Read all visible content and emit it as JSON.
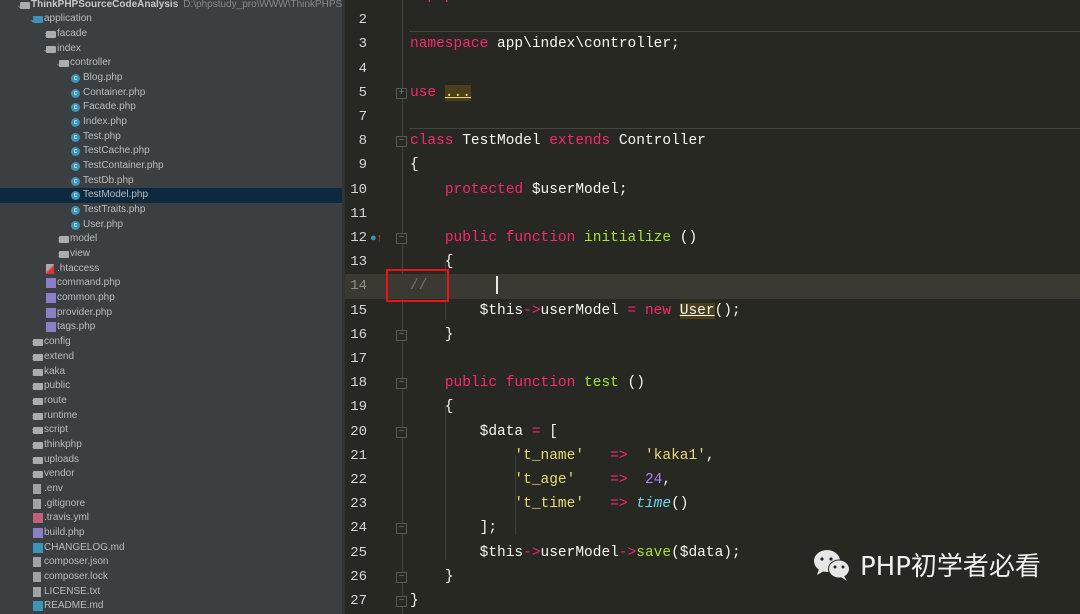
{
  "project_tree": [
    {
      "depth": 0,
      "type": "folder",
      "open": true,
      "label": "ThinkPHPSourceCodeAnalysis",
      "path": "D:\\phpstudy_pro\\WWW\\ThinkPHPSourceCodeAnalysis"
    },
    {
      "depth": 1,
      "type": "folder-blue",
      "open": true,
      "label": "application"
    },
    {
      "depth": 2,
      "type": "folder",
      "open": false,
      "label": "facade"
    },
    {
      "depth": 2,
      "type": "folder",
      "open": true,
      "label": "index"
    },
    {
      "depth": 3,
      "type": "folder",
      "open": true,
      "label": "controller"
    },
    {
      "depth": 4,
      "type": "cls",
      "label": "Blog.php"
    },
    {
      "depth": 4,
      "type": "cls",
      "label": "Container.php"
    },
    {
      "depth": 4,
      "type": "cls",
      "label": "Facade.php"
    },
    {
      "depth": 4,
      "type": "cls",
      "label": "Index.php"
    },
    {
      "depth": 4,
      "type": "cls",
      "label": "Test.php"
    },
    {
      "depth": 4,
      "type": "cls",
      "label": "TestCache.php"
    },
    {
      "depth": 4,
      "type": "cls",
      "label": "TestContainer.php"
    },
    {
      "depth": 4,
      "type": "cls",
      "label": "TestDb.php"
    },
    {
      "depth": 4,
      "type": "cls",
      "label": "TestModel.php",
      "selected": true
    },
    {
      "depth": 4,
      "type": "cls",
      "label": "TestTraits.php"
    },
    {
      "depth": 4,
      "type": "cls",
      "label": "User.php"
    },
    {
      "depth": 3,
      "type": "folder",
      "open": false,
      "label": "model"
    },
    {
      "depth": 3,
      "type": "folder",
      "open": false,
      "label": "view"
    },
    {
      "depth": 2,
      "type": "ht",
      "label": ".htaccess"
    },
    {
      "depth": 2,
      "type": "php",
      "label": "command.php"
    },
    {
      "depth": 2,
      "type": "php",
      "label": "common.php"
    },
    {
      "depth": 2,
      "type": "php",
      "label": "provider.php"
    },
    {
      "depth": 2,
      "type": "php",
      "label": "tags.php"
    },
    {
      "depth": 1,
      "type": "folder",
      "open": false,
      "label": "config"
    },
    {
      "depth": 1,
      "type": "folder",
      "open": false,
      "label": "extend"
    },
    {
      "depth": 1,
      "type": "folder",
      "open": false,
      "label": "kaka"
    },
    {
      "depth": 1,
      "type": "folder",
      "open": false,
      "label": "public"
    },
    {
      "depth": 1,
      "type": "folder",
      "open": false,
      "label": "route"
    },
    {
      "depth": 1,
      "type": "folder",
      "open": false,
      "label": "runtime"
    },
    {
      "depth": 1,
      "type": "folder",
      "open": false,
      "label": "script"
    },
    {
      "depth": 1,
      "type": "folder",
      "open": false,
      "label": "thinkphp"
    },
    {
      "depth": 1,
      "type": "folder",
      "open": false,
      "label": "uploads"
    },
    {
      "depth": 1,
      "type": "folder",
      "open": false,
      "label": "vendor"
    },
    {
      "depth": 1,
      "type": "file",
      "label": ".env"
    },
    {
      "depth": 1,
      "type": "file",
      "label": ".gitignore"
    },
    {
      "depth": 1,
      "type": "yml",
      "label": ".travis.yml"
    },
    {
      "depth": 1,
      "type": "php",
      "label": "build.php"
    },
    {
      "depth": 1,
      "type": "md",
      "label": "CHANGELOG.md"
    },
    {
      "depth": 1,
      "type": "file",
      "label": "composer.json"
    },
    {
      "depth": 1,
      "type": "file",
      "label": "composer.lock"
    },
    {
      "depth": 1,
      "type": "file",
      "label": "LICENSE.txt"
    },
    {
      "depth": 1,
      "type": "md",
      "label": "README.md"
    }
  ],
  "editor": {
    "lines": [
      {
        "n": "1",
        "tokens": [
          [
            "k",
            "<?php"
          ]
        ]
      },
      {
        "n": "2",
        "tokens": []
      },
      {
        "n": "3",
        "tokens": [
          [
            "k",
            "namespace"
          ],
          [
            "p",
            " app\\index\\controller;"
          ]
        ]
      },
      {
        "n": "4",
        "tokens": []
      },
      {
        "n": "5",
        "fold": "+",
        "tokens": [
          [
            "k",
            "use"
          ],
          [
            "p",
            " "
          ],
          [
            "s u",
            "..."
          ]
        ]
      },
      {
        "n": "7",
        "tokens": []
      },
      {
        "n": "8",
        "fold": "-",
        "tokens": [
          [
            "k",
            "class"
          ],
          [
            "p",
            " TestModel "
          ],
          [
            "k",
            "extends"
          ],
          [
            "p",
            " Controller"
          ]
        ]
      },
      {
        "n": "9",
        "tokens": [
          [
            "p",
            "{"
          ]
        ]
      },
      {
        "n": "10",
        "tokens": [
          [
            "p",
            "    "
          ],
          [
            "k",
            "protected"
          ],
          [
            "p",
            " $userModel;"
          ]
        ]
      },
      {
        "n": "11",
        "tokens": []
      },
      {
        "n": "12",
        "fold": "-",
        "override": true,
        "tokens": [
          [
            "p",
            "    "
          ],
          [
            "k",
            "public function"
          ],
          [
            "p",
            " "
          ],
          [
            "f",
            "initialize"
          ],
          [
            "p",
            " ()"
          ]
        ]
      },
      {
        "n": "13",
        "tokens": [
          [
            "p",
            "    {"
          ]
        ]
      },
      {
        "n": "14",
        "current": true,
        "tokens": [
          [
            "c",
            "//"
          ]
        ]
      },
      {
        "n": "15",
        "tokens": [
          [
            "p",
            "        $this"
          ],
          [
            "k",
            "->"
          ],
          [
            "p",
            "userModel "
          ],
          [
            "k",
            "="
          ],
          [
            "p",
            " "
          ],
          [
            "k",
            "new"
          ],
          [
            "p",
            " "
          ],
          [
            "p u",
            "User"
          ],
          [
            "p",
            "();"
          ]
        ]
      },
      {
        "n": "16",
        "fold": "-",
        "tokens": [
          [
            "p",
            "    }"
          ]
        ]
      },
      {
        "n": "17",
        "tokens": []
      },
      {
        "n": "18",
        "fold": "-",
        "tokens": [
          [
            "p",
            "    "
          ],
          [
            "k",
            "public function"
          ],
          [
            "p",
            " "
          ],
          [
            "f",
            "test"
          ],
          [
            "p",
            " ()"
          ]
        ]
      },
      {
        "n": "19",
        "tokens": [
          [
            "p",
            "    {"
          ]
        ]
      },
      {
        "n": "20",
        "fold": "-",
        "tokens": [
          [
            "p",
            "        $data "
          ],
          [
            "k",
            "="
          ],
          [
            "p",
            " ["
          ]
        ]
      },
      {
        "n": "21",
        "tokens": [
          [
            "p",
            "            "
          ],
          [
            "s",
            "'t_name'"
          ],
          [
            "p",
            "   "
          ],
          [
            "k",
            "=>"
          ],
          [
            "p",
            "  "
          ],
          [
            "s",
            "'kaka1'"
          ],
          [
            "p",
            ","
          ]
        ]
      },
      {
        "n": "22",
        "tokens": [
          [
            "p",
            "            "
          ],
          [
            "s",
            "'t_age'"
          ],
          [
            "p",
            "    "
          ],
          [
            "k",
            "=>"
          ],
          [
            "p",
            "  "
          ],
          [
            "n",
            "24"
          ],
          [
            "p",
            ","
          ]
        ]
      },
      {
        "n": "23",
        "tokens": [
          [
            "p",
            "            "
          ],
          [
            "s",
            "'t_time'"
          ],
          [
            "p",
            "   "
          ],
          [
            "k",
            "=>"
          ],
          [
            "p",
            " "
          ],
          [
            "i",
            "time"
          ],
          [
            "p",
            "()"
          ]
        ]
      },
      {
        "n": "24",
        "fold": "-",
        "tokens": [
          [
            "p",
            "        ];"
          ]
        ]
      },
      {
        "n": "25",
        "tokens": [
          [
            "p",
            "        $this"
          ],
          [
            "k",
            "->"
          ],
          [
            "p",
            "userModel"
          ],
          [
            "k",
            "->"
          ],
          [
            "f",
            "save"
          ],
          [
            "p",
            "($data);"
          ]
        ]
      },
      {
        "n": "26",
        "fold": "-",
        "tokens": [
          [
            "p",
            "    }"
          ]
        ]
      },
      {
        "n": "27",
        "fold": "-",
        "tokens": [
          [
            "p",
            "}"
          ]
        ]
      }
    ]
  },
  "watermark": {
    "text": "PHP初学者必看"
  }
}
